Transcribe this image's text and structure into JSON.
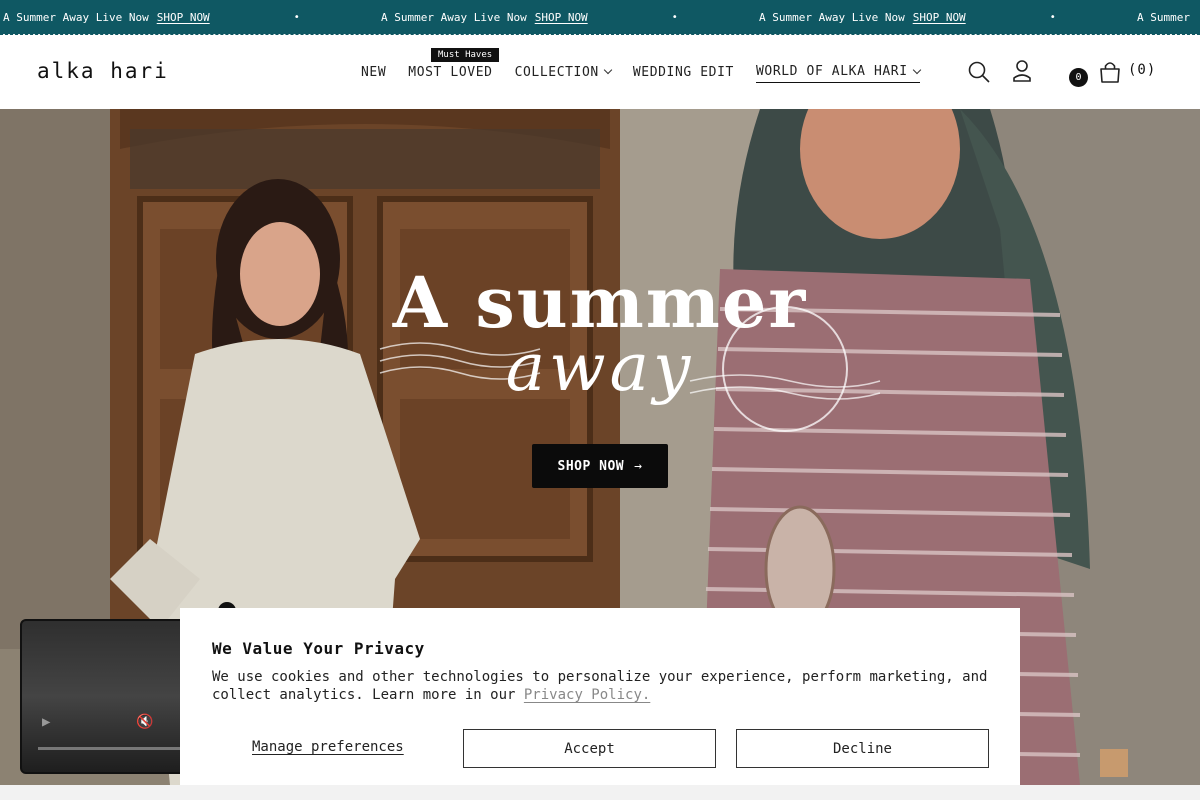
{
  "announcement": {
    "items": [
      {
        "text": "A Summer Away Live Now",
        "link": "SHOP NOW"
      },
      {
        "text": "A Summer Away Live Now",
        "link": "SHOP NOW"
      },
      {
        "text": "A Summer Away Live Now",
        "link": "SHOP NOW"
      },
      {
        "text": "A Summer",
        "link": ""
      }
    ],
    "separator": "•"
  },
  "header": {
    "logo": "alka hari",
    "nav": [
      {
        "label": "NEW"
      },
      {
        "label": "MOST LOVED"
      },
      {
        "label": "COLLECTION"
      },
      {
        "label": "WEDDING EDIT"
      },
      {
        "label": "WORLD OF ALKA HARI"
      }
    ],
    "tag": "Must Haves",
    "badge_count": "0",
    "cart_count": "(0)"
  },
  "hero": {
    "title": "A summer",
    "subtitle": "away",
    "button_label": "SHOP NOW",
    "button_arrow": "→"
  },
  "video": {
    "play_icon": "▶",
    "mute_icon": "🔇"
  },
  "cookie": {
    "title": "We Value Your Privacy",
    "body": "We use cookies and other technologies to personalize your experience, perform marketing, and collect analytics. Learn more in our",
    "policy_link": "Privacy Policy.",
    "manage_label": "Manage preferences",
    "accept_label": "Accept",
    "decline_label": "Decline"
  },
  "colors": {
    "announcement_bg": "#0f5863",
    "button_bg": "#0b0b0b"
  }
}
